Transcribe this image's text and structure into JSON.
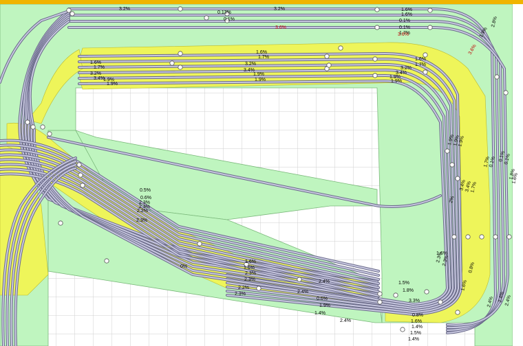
{
  "colors": {
    "background": "#ffffff",
    "grid": "#cfcfcf",
    "baseboard": "#bff5bf",
    "ballast": "#eef55a",
    "rail": "#6a6a8a",
    "sleeper": "#c8c8e0",
    "top_border": "#f0b400",
    "grade_black": "#000000",
    "grade_red": "#c00000",
    "node": "#ffffff"
  },
  "grade_labels_top": [
    "3.2%",
    "3.2%",
    "1.6%",
    "1.6%",
    "0.1%",
    "0.1%",
    "1.7%",
    "3.6%",
    "3.6%",
    "0.13%",
    "0.1%"
  ],
  "grade_labels_upper_loop": [
    "1.6%",
    "1.7%",
    "3.2%",
    "3.4%",
    "1.9%",
    "1.9%",
    "1.6%",
    "1.7%",
    "3.2%",
    "3.4%",
    "1.9%",
    "1.9%",
    "1.6%",
    "1.7%",
    "3.2%",
    "3.4%",
    "1.9%",
    "1.9%"
  ],
  "grade_labels_left_fan": [
    "0.5%",
    "0.6%",
    "2.3%",
    "2.3%",
    "2.2%",
    "2.3%"
  ],
  "grade_labels_lower": [
    "1.6%",
    "1.6%",
    "2.3%",
    "2.3%",
    "2.2%",
    "2.3%",
    "0%",
    "2.4%",
    "2.4%",
    "0.6%",
    "1.9%",
    "1.4%",
    "2.4%",
    "1.5%",
    "1.8%",
    "3.3%",
    "0.8%",
    "1.6%",
    "1.4%",
    "1.5%",
    "1.4%",
    "1.6%"
  ],
  "grade_labels_right": [
    "1.9%",
    "1.9%",
    "1.9%",
    "2%",
    "3.4%",
    "3.4%",
    "1.7%",
    "1.7%",
    "0.1%",
    "2.8%",
    "0.1%",
    "1.8%",
    "1.6%",
    "0.1%",
    "1.9%",
    "3.6%",
    "2.3%",
    "2.3%",
    "2.4%",
    "0.8%",
    "1.6%",
    "2.4%",
    "2.4%"
  ]
}
